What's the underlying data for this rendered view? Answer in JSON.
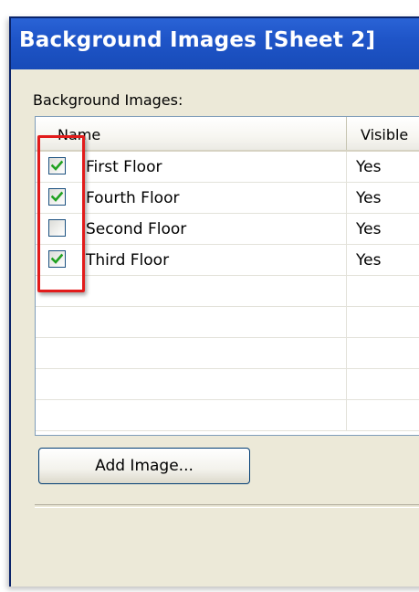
{
  "window": {
    "title": "Background Images [Sheet 2]"
  },
  "section": {
    "label": "Background Images:"
  },
  "list": {
    "columns": [
      "Name",
      "Visible"
    ],
    "rows": [
      {
        "name": "First Floor",
        "checked": true,
        "visible": "Yes"
      },
      {
        "name": "Fourth Floor",
        "checked": true,
        "visible": "Yes"
      },
      {
        "name": "Second Floor",
        "checked": false,
        "visible": "Yes"
      },
      {
        "name": "Third Floor",
        "checked": true,
        "visible": "Yes"
      }
    ],
    "empty_rows": 5
  },
  "buttons": {
    "add_image": "Add Image..."
  },
  "colors": {
    "titlebar": "#1f55c8",
    "dialog_bg": "#ece9d8",
    "checkmark": "#21a121",
    "highlight": "#e21b1b"
  },
  "icons": {
    "checkbox_checked": "checkmark-icon"
  }
}
